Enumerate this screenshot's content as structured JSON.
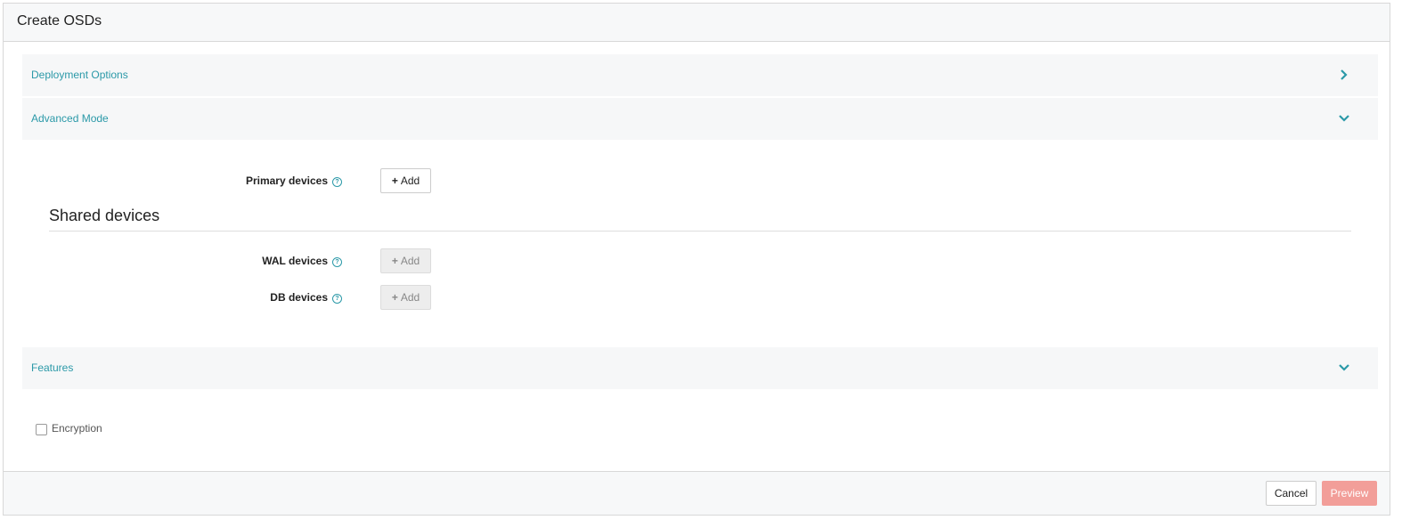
{
  "header": {
    "title": "Create OSDs"
  },
  "accordions": {
    "deployment_options": "Deployment Options",
    "advanced_mode": "Advanced Mode",
    "features": "Features"
  },
  "advanced": {
    "primary_devices_label": "Primary devices",
    "shared_devices_title": "Shared devices",
    "wal_devices_label": "WAL devices",
    "db_devices_label": "DB devices",
    "add_label": "Add",
    "add_icon": "plus-icon",
    "help_icon": "question-circle-icon"
  },
  "features": {
    "encryption_label": "Encryption",
    "encryption_checked": false
  },
  "footer": {
    "cancel_label": "Cancel",
    "preview_label": "Preview"
  },
  "colors": {
    "accent": "#2b99a8",
    "preview_button": "#f29e99",
    "panel_background": "#f6f7f8"
  }
}
